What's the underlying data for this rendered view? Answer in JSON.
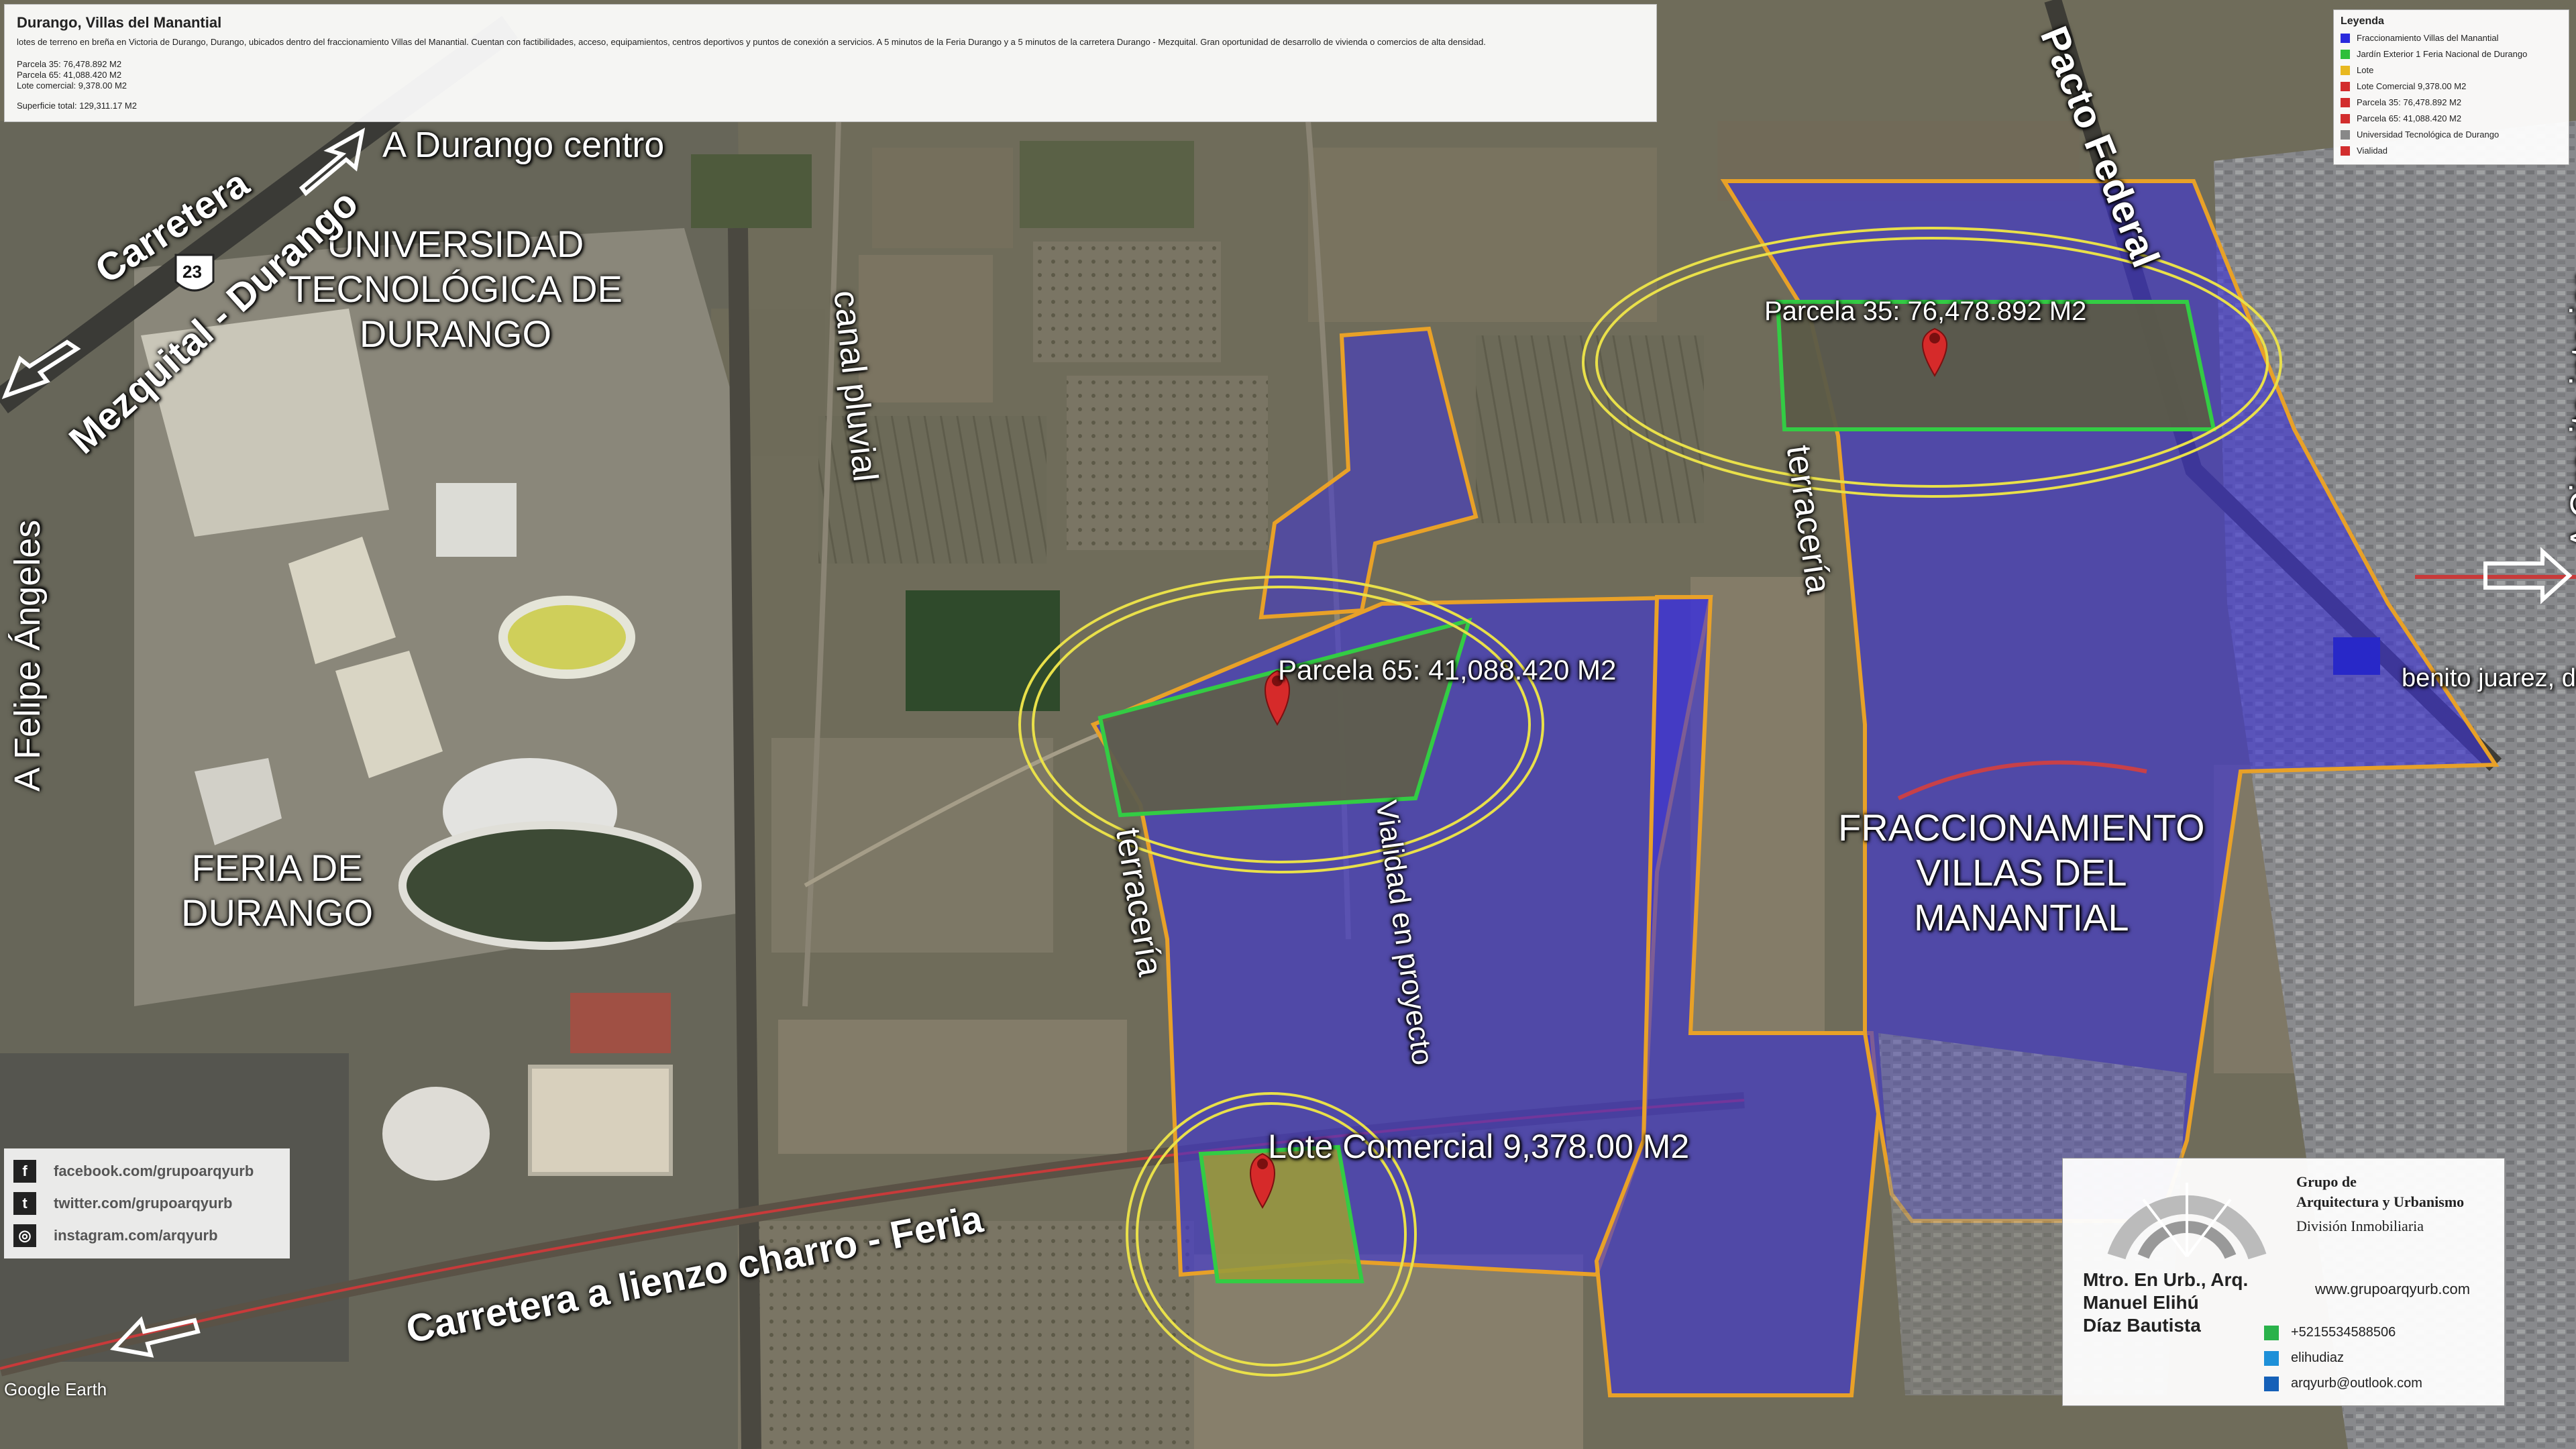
{
  "info": {
    "title": "Durango, Villas del Manantial",
    "description": "lotes de terreno en breña en Victoria de Durango, Durango, ubicados dentro del fraccionamiento Villas del Manantial. Cuentan con factibilidades, acceso, equipamientos, centros deportivos y puntos de conexión a servicios. A 5 minutos de la Feria Durango y a 5 minutos de la carretera Durango - Mezquital. Gran oportunidad de desarrollo de vivienda o comercios de alta densidad.",
    "parcels": [
      "Parcela 35: 76,478.892 M2",
      "Parcela 65: 41,088.420 M2",
      "Lote comercial: 9,378.00 M2"
    ],
    "total": "Superficie total: 129,311.17 M2"
  },
  "legend": {
    "title": "Leyenda",
    "items": [
      {
        "label": "Fraccionamiento Villas del Manantial",
        "color": "#2a2adc"
      },
      {
        "label": "Jardín Exterior 1 Feria Nacional de Durango",
        "color": "#2fbf3a"
      },
      {
        "label": "Lote",
        "color": "#e8b820"
      },
      {
        "label": "Lote Comercial 9,378.00 M2",
        "color": "#d22d2d"
      },
      {
        "label": "Parcela 35: 76,478.892 M2",
        "color": "#d22d2d"
      },
      {
        "label": "Parcela 65: 41,088.420 M2",
        "color": "#d22d2d"
      },
      {
        "label": "Universidad Tecnológica de Durango",
        "color": "#888888"
      },
      {
        "label": "Vialidad",
        "color": "#d22d2d"
      }
    ]
  },
  "labels": {
    "parcela35": "Parcela 35: 76,478.892 M2",
    "parcela65": "Parcela 65: 41,088.420 M2",
    "lote": "Lote Comercial 9,378.00 M2",
    "universidad": [
      "UNIVERSIDAD",
      "TECNOLÓGICA DE",
      "DURANGO"
    ],
    "feria": [
      "FERIA DE",
      "DURANGO"
    ],
    "fraccionamiento": [
      "FRACCIONAMIENTO",
      "VILLAS DEL",
      "MANANTIAL"
    ],
    "a_durango_centro": "A Durango centro",
    "carretera": "Carretera",
    "mezquital": "Mezquital - Durango",
    "route_number": "23",
    "a_felipe_angeles": "A Felipe Ángeles",
    "canal_pluvial": "canal pluvial",
    "terraceria": "terracería",
    "vialidad_proyecto": "Vialidad en proyecto",
    "pacto_federal": "Pacto Federal",
    "a_circuito_interior": "A Circuito interior",
    "benito_juarez": "benito juarez, dura",
    "carretera_lienzo": "Carretera a lienzo charro - Feria",
    "google_earth": "Google Earth"
  },
  "social": [
    {
      "icon": "f",
      "name": "facebook-icon",
      "text": "facebook.com/grupoarqyurb"
    },
    {
      "icon": "t",
      "name": "twitter-icon",
      "text": "twitter.com/grupoarqyurb"
    },
    {
      "icon": "◎",
      "name": "instagram-icon",
      "text": "instagram.com/arqyurb"
    }
  ],
  "card": {
    "group_lines": [
      "Grupo de",
      "Arquitectura y Urbanismo"
    ],
    "division": "División Inmobiliaria",
    "person_lines": [
      "Mtro. En Urb., Arq.",
      "Manuel Elihú",
      "Díaz Bautista"
    ],
    "website": "www.grupoarqyurb.com",
    "phone": "+5215534588506",
    "skype": "elihudiaz",
    "email": "arqyurb@outlook.com"
  }
}
